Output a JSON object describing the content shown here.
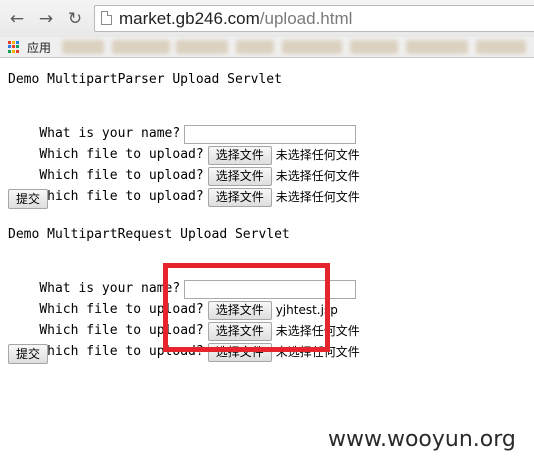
{
  "browser": {
    "back_glyph": "←",
    "forward_glyph": "→",
    "reload_glyph": "↻",
    "url_host": "market.gb246.com",
    "url_path": "/upload.html",
    "bookmarks_bar": {
      "apps_label": "应用"
    }
  },
  "form1": {
    "heading": "Demo MultipartParser Upload Servlet",
    "name_label": "What is your name?",
    "name_value": "",
    "file_rows": [
      {
        "label": "Which file to upload?",
        "button": "选择文件",
        "status": "未选择任何文件"
      },
      {
        "label": "Which file to upload?",
        "button": "选择文件",
        "status": "未选择任何文件"
      },
      {
        "label": "Which file to upload?",
        "button": "选择文件",
        "status": "未选择任何文件"
      }
    ],
    "submit": "提交"
  },
  "form2": {
    "heading": "Demo MultipartRequest Upload Servlet",
    "name_label": "What is your name?",
    "name_value": "",
    "file_rows": [
      {
        "label": "Which file to upload?",
        "button": "选择文件",
        "status": "yjhtest.jsp"
      },
      {
        "label": "Which file to upload?",
        "button": "选择文件",
        "status": "未选择任何文件"
      },
      {
        "label": "Which file to upload?",
        "button": "选择文件",
        "status": "未选择任何文件"
      }
    ],
    "submit": "提交"
  },
  "annotation": {
    "highlight_color": "#e5252b"
  },
  "watermark": "www.wooyun.org"
}
